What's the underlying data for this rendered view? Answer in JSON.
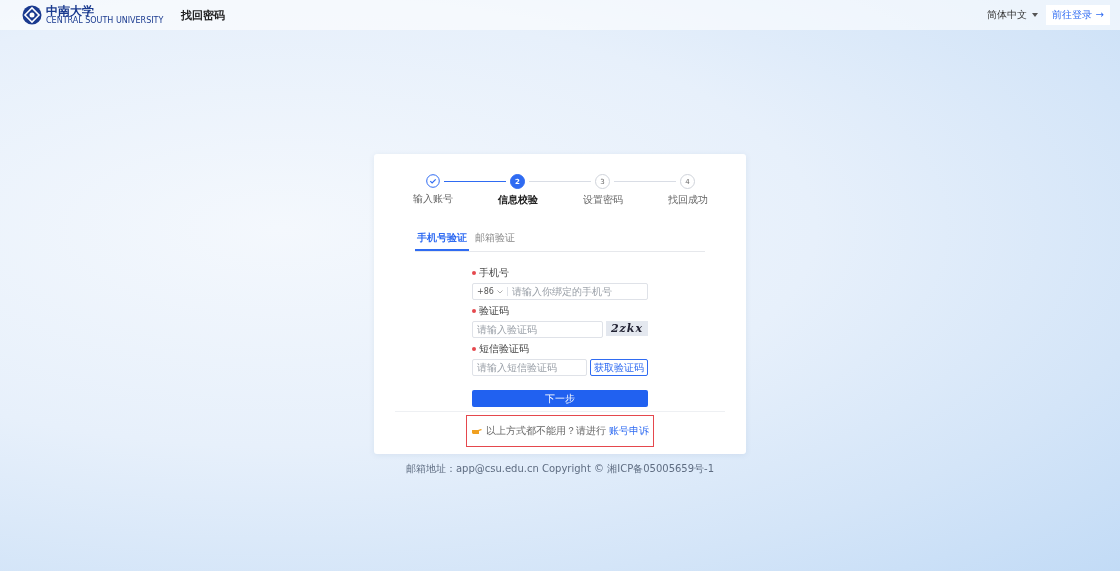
{
  "header": {
    "logo_text": "中南大学",
    "logo_subtext": "CENTRAL SOUTH UNIVERSITY",
    "title": "找回密码",
    "language": "简体中文",
    "login_link": "前往登录 →"
  },
  "steps": [
    {
      "label": "输入账号",
      "completed": true,
      "selected": false
    },
    {
      "number": "2",
      "label": "信息校验",
      "completed": false,
      "selected": true
    },
    {
      "number": "3",
      "label": "设置密码",
      "completed": false,
      "selected": false
    },
    {
      "number": "4",
      "label": "找回成功",
      "completed": false,
      "selected": false
    }
  ],
  "tabs": [
    {
      "label": "手机号验证",
      "selected": true
    },
    {
      "label": "邮箱验证",
      "selected": false
    }
  ],
  "fields": [
    {
      "kind": "phone",
      "label": "手机号",
      "required": true,
      "prefix": "+86",
      "placeholder": "请输入你绑定的手机号"
    },
    {
      "kind": "captcha",
      "label": "验证码",
      "required": true,
      "placeholder": "请输入验证码",
      "captcha": "2zkx"
    },
    {
      "kind": "sms",
      "label": "短信验证码",
      "required": true,
      "placeholder": "请输入短信验证码",
      "button": "获取验证码"
    }
  ],
  "submit": "下一步",
  "help": {
    "text": "以上方式都不能用？请进行",
    "link": "账号申诉",
    "highlighted": true
  },
  "footer": "邮箱地址：app@csu.edu.cn Copyright © 湘ICP备05005659号-1"
}
